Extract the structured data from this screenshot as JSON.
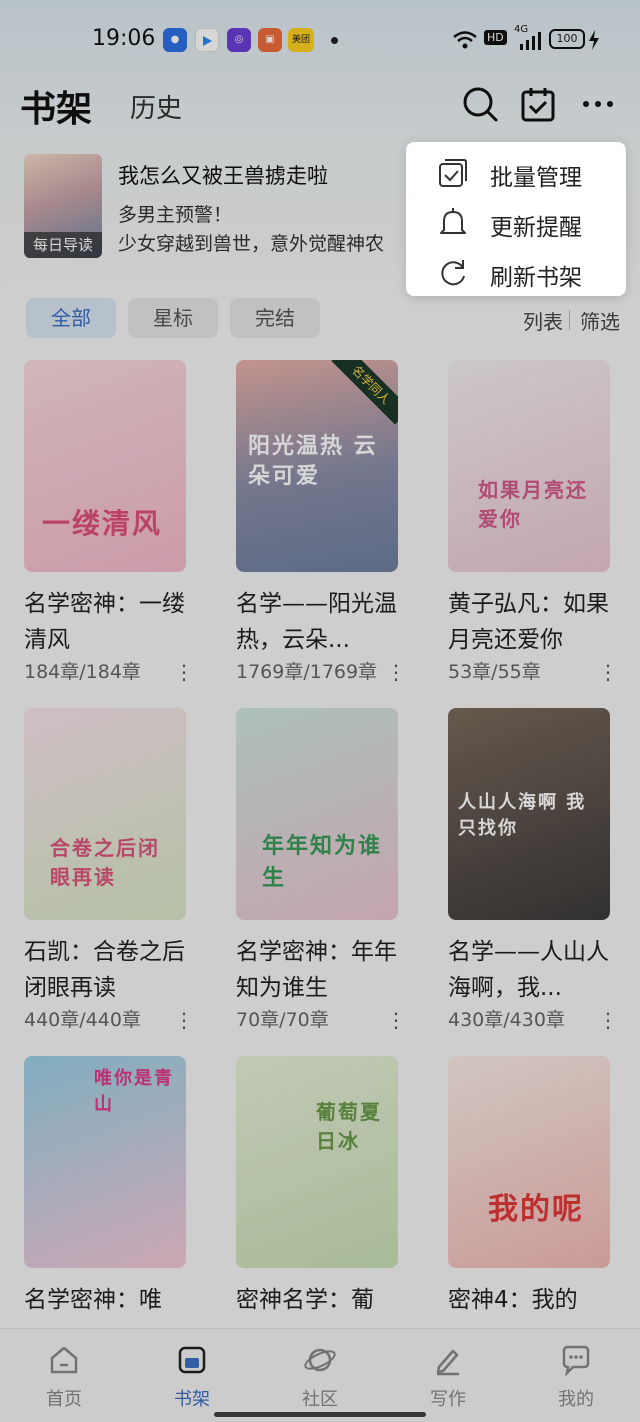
{
  "status_bar": {
    "time": "19:06",
    "notification_icons": [
      "baidu-icon",
      "play-icon",
      "circle-app-icon",
      "orange-app-icon",
      "meituan-icon"
    ],
    "meituan_label": "美团",
    "hd_label": "HD",
    "network_label": "4G",
    "battery": "100"
  },
  "header": {
    "title": "书架",
    "history_tab": "历史",
    "icons": [
      "search-icon",
      "calendar-check-icon",
      "more-icon"
    ]
  },
  "daily_guide": {
    "badge": "每日导读",
    "title": "我怎么又被王兽掳走啦",
    "subtitle": "多男主预警！",
    "description": "少女穿越到兽世，意外觉醒神农"
  },
  "filters": {
    "chips": [
      "全部",
      "星标",
      "完结"
    ],
    "active_chip": "全部",
    "view_list": "列表",
    "view_filter": "筛选"
  },
  "books": [
    {
      "title": "名学密神：一缕清风",
      "progress": "184章/184章",
      "cover_text": "一缕清风",
      "cover_colors": [
        "#f7d9de",
        "#f4b9c9"
      ]
    },
    {
      "title": "名学——阳光温热，云朵...",
      "progress": "1769章/1769章",
      "cover_text": "阳光温热 云朵可爱",
      "cover_colors": [
        "#e8b0a8",
        "#6f7fa0"
      ],
      "ribbon": "名学同人"
    },
    {
      "title": "黄子弘凡：如果月亮还爱你",
      "progress": "53章/55章",
      "cover_text": "如果月亮还爱你",
      "cover_colors": [
        "#f3eef0",
        "#e9c6d3"
      ]
    },
    {
      "title": "石凯：合卷之后闭眼再读",
      "progress": "440章/440章",
      "cover_text": "合卷之后闭眼再读",
      "cover_colors": [
        "#f6e3ea",
        "#d7e6c6"
      ]
    },
    {
      "title": "名学密神：年年知为谁生",
      "progress": "70章/70章",
      "cover_text": "年年知为谁生",
      "cover_colors": [
        "#cfe6dd",
        "#e9c4d2"
      ]
    },
    {
      "title": "名学——人山人海啊，我...",
      "progress": "430章/430章",
      "cover_text": "人山人海啊 我只找你",
      "cover_colors": [
        "#7a6a5c",
        "#3c3a3a"
      ]
    },
    {
      "title": "名学密神：唯",
      "progress": "",
      "cover_text": "唯你是青山",
      "cover_colors": [
        "#9ad0e6",
        "#f4c8d6"
      ]
    },
    {
      "title": "密神名学：葡",
      "progress": "",
      "cover_text": "葡萄夏日冰",
      "cover_colors": [
        "#e7f0d8",
        "#c9dfb5"
      ]
    },
    {
      "title": "密神4：我的",
      "progress": "",
      "cover_text": "我的呢",
      "cover_colors": [
        "#f9ece6",
        "#f1b8b5"
      ]
    }
  ],
  "popup_menu": {
    "items": [
      {
        "label": "批量管理",
        "icon": "batch-manage-icon"
      },
      {
        "label": "更新提醒",
        "icon": "bell-icon"
      },
      {
        "label": "刷新书架",
        "icon": "refresh-icon"
      }
    ]
  },
  "bottom_nav": {
    "items": [
      {
        "label": "首页",
        "icon": "home-icon"
      },
      {
        "label": "书架",
        "icon": "bookshelf-icon"
      },
      {
        "label": "社区",
        "icon": "planet-icon"
      },
      {
        "label": "写作",
        "icon": "pen-icon"
      },
      {
        "label": "我的",
        "icon": "message-icon"
      }
    ],
    "active": "书架"
  },
  "colors": {
    "accent": "#3a6fc4",
    "active_chip_bg": "#dbe6f3"
  }
}
